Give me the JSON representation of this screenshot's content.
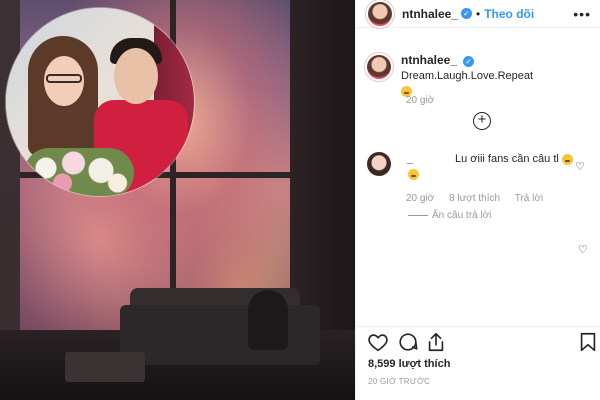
{
  "header": {
    "username": "ntnhalee_",
    "verified": "✓",
    "separator": "•",
    "follow_label": "Theo dõi",
    "more_label": "•••"
  },
  "caption": {
    "username": "ntnhalee_",
    "text": "Dream.Laugh.Love.Repeat",
    "time": "20 giờ"
  },
  "load_more_label": "+",
  "comments": [
    {
      "username": "_",
      "text": "Lu ơiii fans cần câu tl",
      "time": "20 giờ",
      "likes": "8 lượt thích",
      "reply_label": "Trả lời",
      "hide_replies_label": "Ẩn câu trả lời"
    }
  ],
  "post": {
    "likes": "8,599 lượt thích",
    "posted_ago": "20 GIỜ TRƯỚC"
  },
  "colors": {
    "link": "#3897f0",
    "muted": "#999999",
    "text": "#262626"
  },
  "icons": [
    "heart-icon",
    "comment-icon",
    "share-icon",
    "bookmark-icon",
    "add-circle-icon",
    "more-icon",
    "verified-icon"
  ]
}
